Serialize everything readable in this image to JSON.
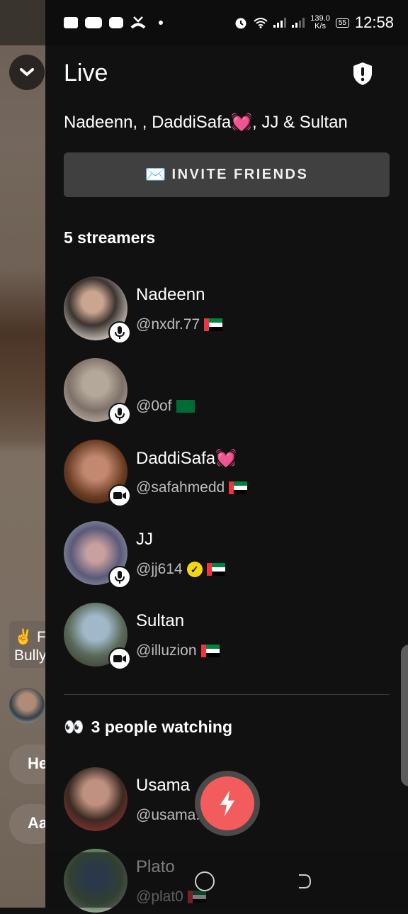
{
  "status_bar": {
    "icons": [
      "messages-icon",
      "youtube-icon",
      "gamepad-icon",
      "missed-call-icon",
      "dot-icon"
    ],
    "right_icons": [
      "alarm-icon",
      "wifi-icon",
      "signal-icon",
      "signal-icon"
    ],
    "speed_value": "139.0",
    "speed_unit": "K/s",
    "battery": "55",
    "time": "12:58"
  },
  "background": {
    "collapse_icon": "chevron-down-icon",
    "chat_emoji": "✌️",
    "chat_partial_text_1": "F",
    "chat_partial_text_2": "Bully",
    "pill_1": "He",
    "pill_2": "Aa"
  },
  "header": {
    "title": "Live",
    "safety_icon": "shield-alert-icon",
    "participants": "Nadeenn,    , DaddiSafa💓, JJ & Sultan"
  },
  "invite": {
    "emoji": "✉️",
    "label": "INVITE FRIENDS"
  },
  "streamers": {
    "heading": "5 streamers",
    "items": [
      {
        "name": "Nadeenn",
        "handle": "@nxdr.77",
        "flag": "uae",
        "mode": "mic",
        "verified": false
      },
      {
        "name": "",
        "handle": "@0of",
        "flag": "sa",
        "mode": "mic",
        "verified": false
      },
      {
        "name": "DaddiSafa💓",
        "handle": "@safahmedd",
        "flag": "uae",
        "mode": "video",
        "verified": false
      },
      {
        "name": "JJ",
        "handle": "@jj614",
        "flag": "uae",
        "mode": "mic",
        "verified": true
      },
      {
        "name": "Sultan",
        "handle": "@illuzion",
        "flag": "uae",
        "mode": "video",
        "verified": false
      }
    ]
  },
  "watchers": {
    "emoji": "👀",
    "heading": "3 people watching",
    "items": [
      {
        "name": "Usama",
        "handle": "@usama.s",
        "flag": "pk"
      },
      {
        "name": "Plato",
        "handle": "@plat0",
        "flag": "uae"
      }
    ]
  },
  "fab": {
    "icon": "lightning-icon"
  },
  "nav": {
    "home_icon": "home-circle-icon",
    "back_icon": "back-icon"
  }
}
